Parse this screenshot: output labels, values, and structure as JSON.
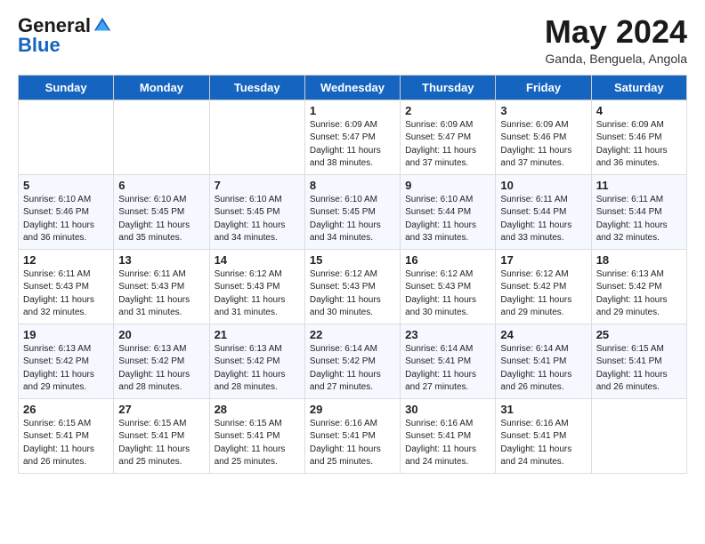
{
  "header": {
    "logo_general": "General",
    "logo_blue": "Blue",
    "title": "May 2024",
    "subtitle": "Ganda, Benguela, Angola"
  },
  "days_of_week": [
    "Sunday",
    "Monday",
    "Tuesday",
    "Wednesday",
    "Thursday",
    "Friday",
    "Saturday"
  ],
  "weeks": [
    [
      {
        "day": "",
        "info": ""
      },
      {
        "day": "",
        "info": ""
      },
      {
        "day": "",
        "info": ""
      },
      {
        "day": "1",
        "info": "Sunrise: 6:09 AM\nSunset: 5:47 PM\nDaylight: 11 hours\nand 38 minutes."
      },
      {
        "day": "2",
        "info": "Sunrise: 6:09 AM\nSunset: 5:47 PM\nDaylight: 11 hours\nand 37 minutes."
      },
      {
        "day": "3",
        "info": "Sunrise: 6:09 AM\nSunset: 5:46 PM\nDaylight: 11 hours\nand 37 minutes."
      },
      {
        "day": "4",
        "info": "Sunrise: 6:09 AM\nSunset: 5:46 PM\nDaylight: 11 hours\nand 36 minutes."
      }
    ],
    [
      {
        "day": "5",
        "info": "Sunrise: 6:10 AM\nSunset: 5:46 PM\nDaylight: 11 hours\nand 36 minutes."
      },
      {
        "day": "6",
        "info": "Sunrise: 6:10 AM\nSunset: 5:45 PM\nDaylight: 11 hours\nand 35 minutes."
      },
      {
        "day": "7",
        "info": "Sunrise: 6:10 AM\nSunset: 5:45 PM\nDaylight: 11 hours\nand 34 minutes."
      },
      {
        "day": "8",
        "info": "Sunrise: 6:10 AM\nSunset: 5:45 PM\nDaylight: 11 hours\nand 34 minutes."
      },
      {
        "day": "9",
        "info": "Sunrise: 6:10 AM\nSunset: 5:44 PM\nDaylight: 11 hours\nand 33 minutes."
      },
      {
        "day": "10",
        "info": "Sunrise: 6:11 AM\nSunset: 5:44 PM\nDaylight: 11 hours\nand 33 minutes."
      },
      {
        "day": "11",
        "info": "Sunrise: 6:11 AM\nSunset: 5:44 PM\nDaylight: 11 hours\nand 32 minutes."
      }
    ],
    [
      {
        "day": "12",
        "info": "Sunrise: 6:11 AM\nSunset: 5:43 PM\nDaylight: 11 hours\nand 32 minutes."
      },
      {
        "day": "13",
        "info": "Sunrise: 6:11 AM\nSunset: 5:43 PM\nDaylight: 11 hours\nand 31 minutes."
      },
      {
        "day": "14",
        "info": "Sunrise: 6:12 AM\nSunset: 5:43 PM\nDaylight: 11 hours\nand 31 minutes."
      },
      {
        "day": "15",
        "info": "Sunrise: 6:12 AM\nSunset: 5:43 PM\nDaylight: 11 hours\nand 30 minutes."
      },
      {
        "day": "16",
        "info": "Sunrise: 6:12 AM\nSunset: 5:43 PM\nDaylight: 11 hours\nand 30 minutes."
      },
      {
        "day": "17",
        "info": "Sunrise: 6:12 AM\nSunset: 5:42 PM\nDaylight: 11 hours\nand 29 minutes."
      },
      {
        "day": "18",
        "info": "Sunrise: 6:13 AM\nSunset: 5:42 PM\nDaylight: 11 hours\nand 29 minutes."
      }
    ],
    [
      {
        "day": "19",
        "info": "Sunrise: 6:13 AM\nSunset: 5:42 PM\nDaylight: 11 hours\nand 29 minutes."
      },
      {
        "day": "20",
        "info": "Sunrise: 6:13 AM\nSunset: 5:42 PM\nDaylight: 11 hours\nand 28 minutes."
      },
      {
        "day": "21",
        "info": "Sunrise: 6:13 AM\nSunset: 5:42 PM\nDaylight: 11 hours\nand 28 minutes."
      },
      {
        "day": "22",
        "info": "Sunrise: 6:14 AM\nSunset: 5:42 PM\nDaylight: 11 hours\nand 27 minutes."
      },
      {
        "day": "23",
        "info": "Sunrise: 6:14 AM\nSunset: 5:41 PM\nDaylight: 11 hours\nand 27 minutes."
      },
      {
        "day": "24",
        "info": "Sunrise: 6:14 AM\nSunset: 5:41 PM\nDaylight: 11 hours\nand 26 minutes."
      },
      {
        "day": "25",
        "info": "Sunrise: 6:15 AM\nSunset: 5:41 PM\nDaylight: 11 hours\nand 26 minutes."
      }
    ],
    [
      {
        "day": "26",
        "info": "Sunrise: 6:15 AM\nSunset: 5:41 PM\nDaylight: 11 hours\nand 26 minutes."
      },
      {
        "day": "27",
        "info": "Sunrise: 6:15 AM\nSunset: 5:41 PM\nDaylight: 11 hours\nand 25 minutes."
      },
      {
        "day": "28",
        "info": "Sunrise: 6:15 AM\nSunset: 5:41 PM\nDaylight: 11 hours\nand 25 minutes."
      },
      {
        "day": "29",
        "info": "Sunrise: 6:16 AM\nSunset: 5:41 PM\nDaylight: 11 hours\nand 25 minutes."
      },
      {
        "day": "30",
        "info": "Sunrise: 6:16 AM\nSunset: 5:41 PM\nDaylight: 11 hours\nand 24 minutes."
      },
      {
        "day": "31",
        "info": "Sunrise: 6:16 AM\nSunset: 5:41 PM\nDaylight: 11 hours\nand 24 minutes."
      },
      {
        "day": "",
        "info": ""
      }
    ]
  ]
}
